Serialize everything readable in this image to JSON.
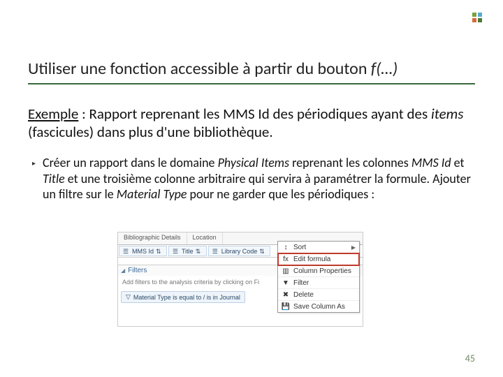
{
  "logo": {
    "name": "app-logo"
  },
  "title": {
    "pre": "Utiliser une fonction accessible à partir du bouton ",
    "fx": "f(…)"
  },
  "example": {
    "label": "Exemple",
    "sep": " : ",
    "a": "Rapport reprenant les MMS Id des périodiques ayant des ",
    "ital": "items",
    "b": " (fascicules) dans plus d'une bibliothèque."
  },
  "bullet": {
    "marker": "▸",
    "p1": "Créer un rapport dans le domaine ",
    "i1": "Physical Items",
    "p2": " reprenant les colonnes ",
    "i2": "MMS Id",
    "p3": " et ",
    "i3": "Title",
    "p4": " et une troisième colonne arbitraire qui servira à paramétrer la formule. Ajouter un filtre sur le ",
    "i4": "Material Type",
    "p5": " pour ne garder que les périodiques :"
  },
  "shot": {
    "tabs": [
      "Bibliographic Details",
      "Location"
    ],
    "cols": [
      "MMS Id",
      "Title",
      "Library Code"
    ],
    "filters_header": "Filters",
    "filters_hint": "Add filters to the analysis criteria by clicking on Fi",
    "filter_pill": "Material Type is equal to / is in Journal"
  },
  "menu": {
    "items": [
      {
        "icon": "↕",
        "label": "Sort",
        "arrow": true,
        "hl": false,
        "name": "menu-item-sort"
      },
      {
        "icon": "fx",
        "label": "Edit formula",
        "arrow": false,
        "hl": true,
        "name": "menu-item-edit-formula"
      },
      {
        "icon": "▥",
        "label": "Column Properties",
        "arrow": false,
        "hl": false,
        "name": "menu-item-column-properties"
      },
      {
        "icon": "▼",
        "label": "Filter",
        "arrow": false,
        "hl": false,
        "name": "menu-item-filter"
      },
      {
        "icon": "✖",
        "label": "Delete",
        "arrow": false,
        "hl": false,
        "name": "menu-item-delete"
      },
      {
        "icon": "💾",
        "label": "Save Column As",
        "arrow": false,
        "hl": false,
        "name": "menu-item-save-column-as"
      }
    ]
  },
  "page_number": "45"
}
